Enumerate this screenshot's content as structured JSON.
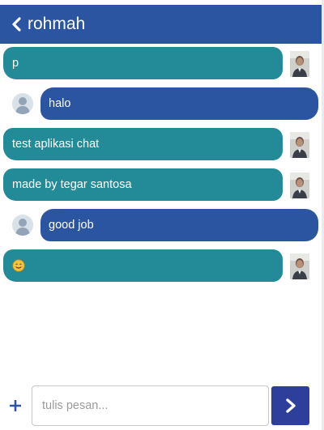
{
  "header": {
    "title": "rohmah",
    "back_icon": "chevron-left-icon"
  },
  "messages": [
    {
      "side": "me",
      "text": "p"
    },
    {
      "side": "them",
      "text": "halo"
    },
    {
      "side": "me",
      "text": "test aplikasi chat"
    },
    {
      "side": "me",
      "text": "made by tegar santosa"
    },
    {
      "side": "them",
      "text": "good job"
    },
    {
      "side": "me",
      "text": "",
      "emoji": "smiling-face-emoji"
    }
  ],
  "composer": {
    "placeholder": "tulis pesan...",
    "value": "",
    "attach_icon": "plus-icon",
    "send_icon": "chevron-right-icon"
  },
  "colors": {
    "header": "#2b55a0",
    "outgoing": "#238b97",
    "incoming": "#2b55a0",
    "send_button": "#2e3e9b"
  }
}
